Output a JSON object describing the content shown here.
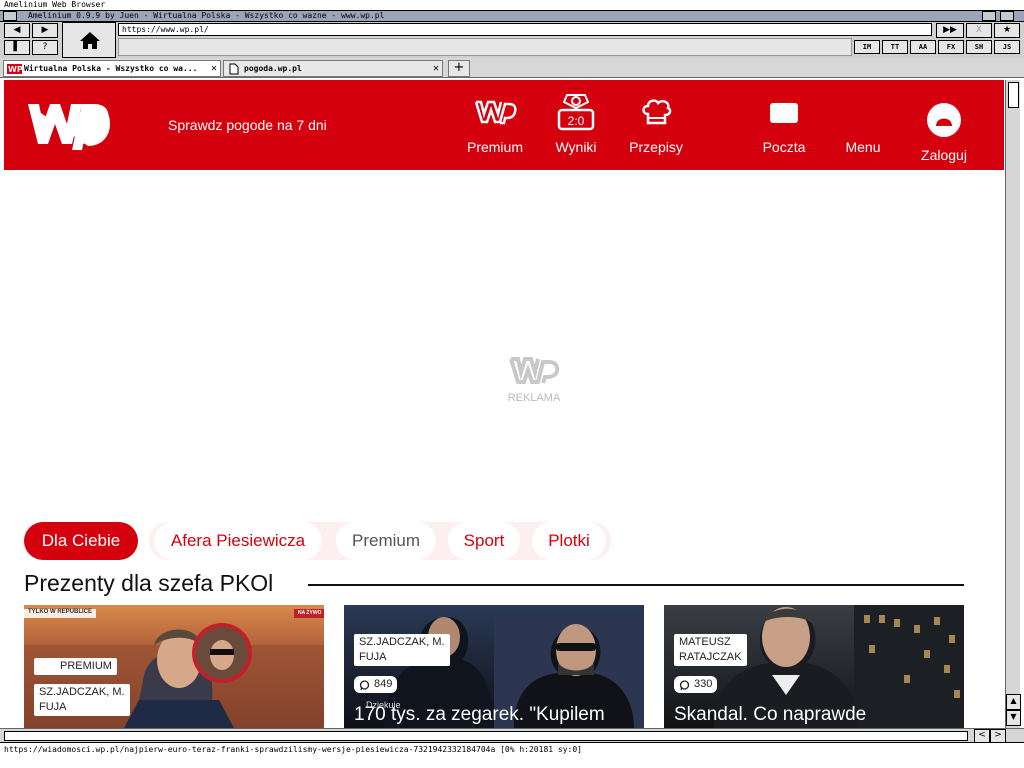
{
  "screen_title": "Amelinium Web Browser",
  "window_title": "Amelinium 0.9.9 by Juen - Wirtualna Polska - Wszystko co wazne - www.wp.pl",
  "toolbar": {
    "back": "◀",
    "forward": "▶",
    "bookmark": "▌",
    "help": "?",
    "url": "https://www.wp.pl/",
    "go": "▶▶",
    "stop": "X",
    "star": "★",
    "switches": [
      "IM",
      "TT",
      "AA",
      "FX",
      "SH",
      "JS"
    ]
  },
  "tabs": [
    {
      "title": "Wirtualna Polska - Wszystko co wa...",
      "close": "✕"
    },
    {
      "title": "pogoda.wp.pl",
      "close": "✕"
    }
  ],
  "newtab": "+",
  "header": {
    "weather_link": "Sprawdz pogode na 7 dni",
    "nav": [
      {
        "label": "Premium"
      },
      {
        "label": "Wyniki",
        "score": "2:0"
      },
      {
        "label": "Przepisy"
      },
      {
        "label": "Poczta"
      },
      {
        "label": "Menu"
      },
      {
        "label": "Zaloguj"
      }
    ]
  },
  "ad": {
    "label": "REKLAMA"
  },
  "pills": [
    "Dla Ciebie",
    "Afera Piesiewicza",
    "Premium",
    "Sport",
    "Plotki"
  ],
  "section_title": "Prezenty dla szefa PKOl",
  "cards": [
    {
      "badge": "PREMIUM",
      "author_line1": "SZ.JADCZAK, M.",
      "author_line2": "FUJA",
      "tv_label": "TYLKO W REPUBLICE",
      "tv_right": "NA ŻYWO"
    },
    {
      "author_line1": "SZ.JADCZAK, M.",
      "author_line2": "FUJA",
      "comments": "849",
      "headline": "170 tys. za zegarek. \"Kupilem",
      "overlay": "Dziekuje"
    },
    {
      "author_line1": "MATEUSZ",
      "author_line2": "RATAJCZAK",
      "comments": "330",
      "headline": "Skandal. Co naprawde"
    }
  ],
  "status": "https://wiadomosci.wp.pl/najpierw-euro-teraz-franki-sprawdzilismy-wersje-piesiewicza-7321942332184704a  [0% h:20181 sy:0]",
  "colors": {
    "brand_red": "#d4000d",
    "pill_bg": "#fdeff0"
  }
}
